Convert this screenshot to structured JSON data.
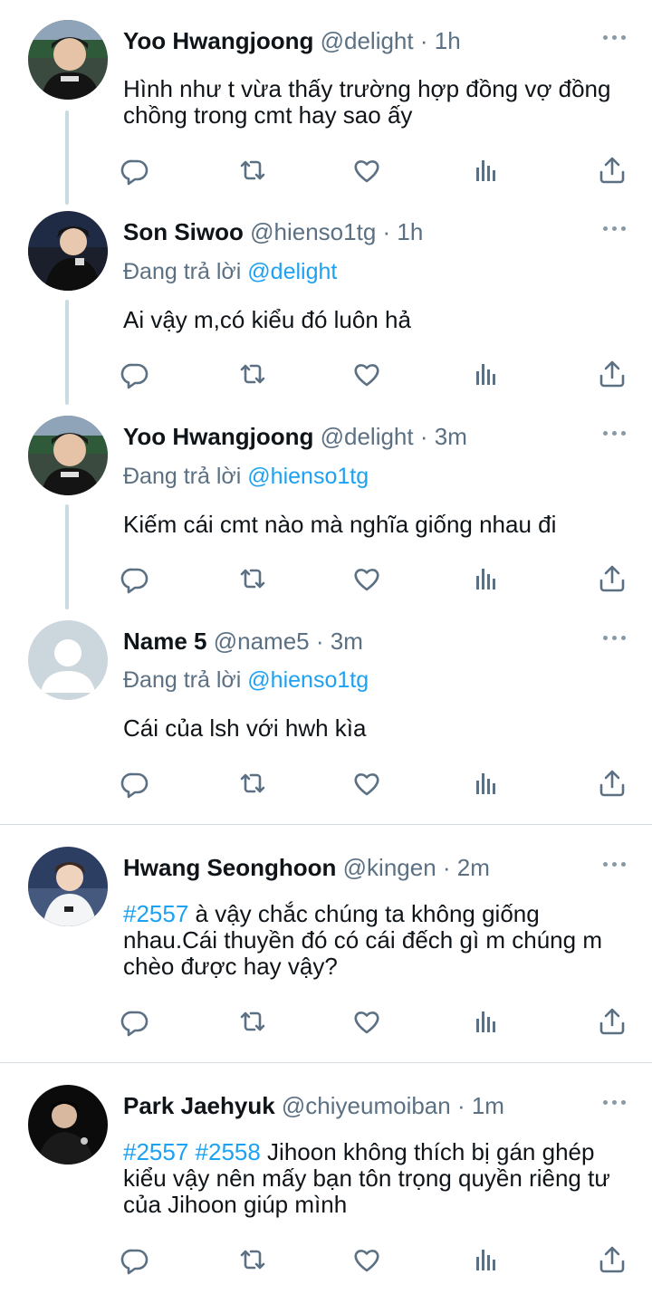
{
  "reply_prefix": "Đang trả lời",
  "icons": {
    "reply": "reply-icon",
    "retweet": "retweet-icon",
    "like": "heart-icon",
    "stats": "stats-icon",
    "share": "share-icon",
    "more": "more-icon"
  },
  "colors": {
    "link": "#1da1f2",
    "meta": "#5b7083",
    "thread_line": "#c9dbe3"
  },
  "tweets": [
    {
      "name": "Yoo Hwangjoong",
      "handle": "@delight",
      "time": "· 1h",
      "reply_to": "",
      "hashtags": "",
      "text": "Hình như t vừa thấy trường hợp đồng vợ đồng chồng trong cmt hay sao ấy"
    },
    {
      "name": "Son Siwoo",
      "handle": "@hienso1tg",
      "time": "· 1h",
      "reply_to": "@delight",
      "hashtags": "",
      "text": "Ai vậy m,có kiểu đó luôn hả"
    },
    {
      "name": "Yoo Hwangjoong",
      "handle": "@delight",
      "time": "· 3m",
      "reply_to": "@hienso1tg",
      "hashtags": "",
      "text": "Kiếm cái cmt nào mà nghĩa giống nhau đi"
    },
    {
      "name": "Name 5",
      "handle": "@name5",
      "time": "· 3m",
      "reply_to": "@hienso1tg",
      "hashtags": "",
      "text": "Cái của lsh với hwh kìa"
    },
    {
      "name": "Hwang Seonghoon",
      "handle": "@kingen",
      "time": "· 2m",
      "reply_to": "",
      "hashtags": "#2557",
      "text": " à vậy chắc chúng ta không giống nhau.Cái thuyền đó có cái đếch gì m chúng m chèo được hay vậy?"
    },
    {
      "name": "Park Jaehyuk",
      "handle": "@chiyeumoiban",
      "time": "· 1m",
      "reply_to": "",
      "hashtags": "#2557 #2558",
      "text": " Jihoon không thích bị gán ghép kiểu vậy nên mấy bạn tôn trọng quyền riêng tư của Jihoon giúp mình"
    }
  ]
}
